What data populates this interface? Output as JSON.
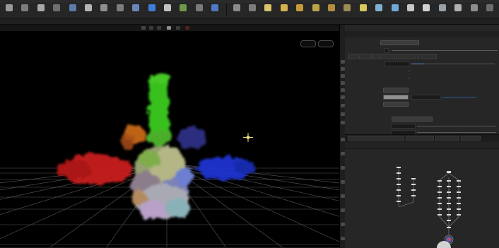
{
  "shelf": {
    "tools": [
      {
        "icon": "box-icon",
        "color": "#9a9a9a"
      },
      {
        "icon": "sphere-icon",
        "color": "#7d7d7d"
      },
      {
        "icon": "tube-icon",
        "color": "#a8a8a8"
      },
      {
        "icon": "torus-icon",
        "color": "#6f6f6f"
      },
      {
        "icon": "grid-icon",
        "color": "#5c7ca8"
      },
      {
        "icon": "null-icon",
        "color": "#b5b5b5"
      },
      {
        "icon": "line-icon",
        "color": "#8f8f8f"
      },
      {
        "icon": "circle-icon",
        "color": "#7d7d7d"
      },
      {
        "icon": "curve-icon",
        "color": "#6a86b8"
      },
      {
        "icon": "spray-paint-icon",
        "color": "#3d7dd8"
      },
      {
        "icon": "font-icon",
        "color": "#c2c2c2"
      },
      {
        "icon": "l-system-icon",
        "color": "#6e9a4a"
      },
      {
        "icon": "platonic-icon",
        "color": "#7a7a7a"
      },
      {
        "icon": "metaball-icon",
        "color": "#4f79c2"
      },
      {
        "icon": "file-icon",
        "color": "#8a8a8a"
      },
      {
        "icon": "camera-icon",
        "color": "#7c7c7c"
      },
      {
        "icon": "light-icon",
        "color": "#d9c36b"
      },
      {
        "icon": "point-light-icon",
        "color": "#d5b24f"
      },
      {
        "icon": "spot-light-icon",
        "color": "#c49a3a"
      },
      {
        "icon": "area-light-icon",
        "color": "#bfa447"
      },
      {
        "icon": "geometry-light-icon",
        "color": "#b28d3b"
      },
      {
        "icon": "volume-light-icon",
        "color": "#9c8a56"
      },
      {
        "icon": "distant-light-icon",
        "color": "#d8c85a"
      },
      {
        "icon": "environment-light-icon",
        "color": "#7fb0cf"
      },
      {
        "icon": "sky-light-icon",
        "color": "#6ea8d8"
      },
      {
        "icon": "gi-light-icon",
        "color": "#c7c7c7"
      },
      {
        "icon": "caustic-light-icon",
        "color": "#d2d2d2"
      },
      {
        "icon": "portal-light-icon",
        "color": "#9aa0a8"
      },
      {
        "icon": "ambient-light-icon",
        "color": "#b0b0b0"
      },
      {
        "icon": "stereo-camera-icon",
        "color": "#8d8d8d"
      },
      {
        "icon": "vr-camera-icon",
        "color": "#6c6c6c"
      }
    ]
  },
  "viewport": {
    "crosshair_icon": "crosshair-icon",
    "colors": {
      "red": "#d41f1f",
      "green": "#3fc11e",
      "blue": "#1f37d6",
      "orange": "#c86a18",
      "grid": "#5a5a5a"
    }
  },
  "network": {
    "colors": {
      "node": "#d8d8d8",
      "wire": "#8e8e8e",
      "output_node": "#4d63c8"
    }
  }
}
